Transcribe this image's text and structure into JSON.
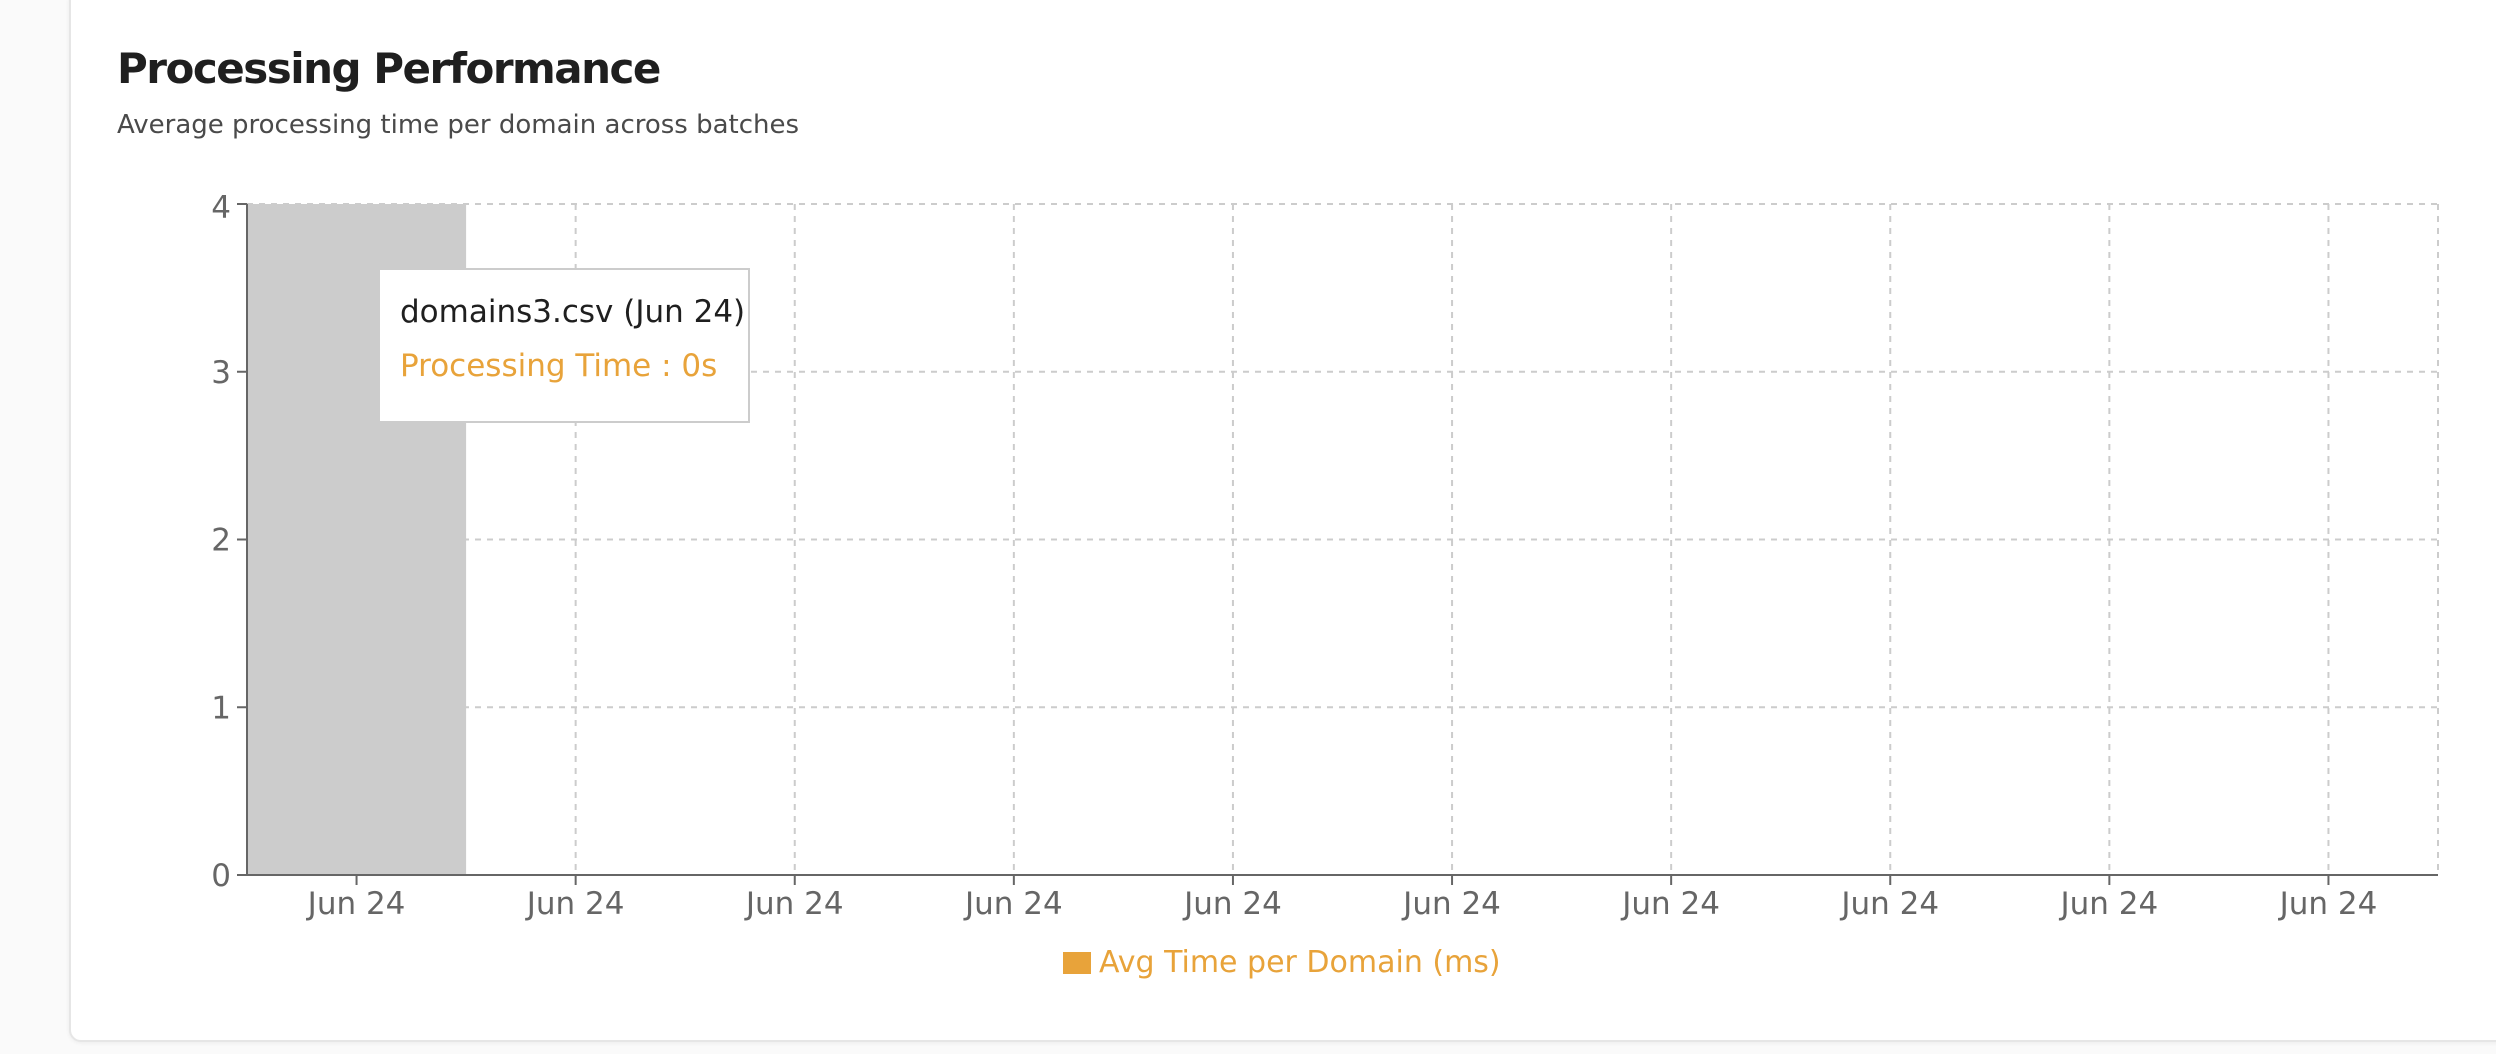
{
  "header": {
    "title": "Processing Performance",
    "subtitle": "Average processing time per domain across batches"
  },
  "tooltip": {
    "label": "domains3.csv (Jun 24)",
    "value_text": "Processing Time : 0s",
    "active_index": 0
  },
  "colors": {
    "series": "#e8a33a",
    "cursor": "#cccccc",
    "grid": "#cccccc",
    "axis": "#666666"
  },
  "chart_data": {
    "type": "bar",
    "categories": [
      "Jun 24",
      "Jun 24",
      "Jun 24",
      "Jun 24",
      "Jun 24",
      "Jun 24",
      "Jun 24",
      "Jun 24",
      "Jun 24",
      "Jun 24"
    ],
    "series": [
      {
        "name": "Avg Time per Domain (ms)",
        "values": [
          0,
          0,
          0,
          0,
          0,
          0,
          0,
          0,
          0,
          0
        ]
      }
    ],
    "yticks": [
      0,
      1,
      2,
      3,
      4
    ],
    "ylim": [
      0,
      4
    ],
    "grid": true,
    "legend": "bottom-center"
  }
}
